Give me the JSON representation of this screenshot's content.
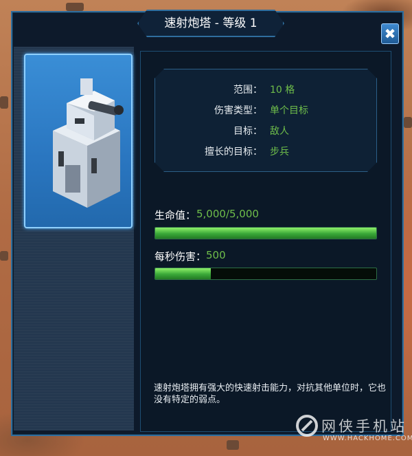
{
  "dialog": {
    "title": "速射炮塔 - 等级 1",
    "close_label": "✖"
  },
  "stats": [
    {
      "label": "范围：",
      "value": "10 格"
    },
    {
      "label": "伤害类型：",
      "value": "单个目标"
    },
    {
      "label": "目标：",
      "value": "敌人"
    },
    {
      "label": "擅长的目标：",
      "value": "步兵"
    }
  ],
  "health": {
    "label": "生命值：",
    "value": "5,000/5,000",
    "fraction": 1.0
  },
  "dps": {
    "label": "每秒伤害：",
    "value": "500",
    "fraction": 0.25
  },
  "description": "速射炮塔拥有强大的快速射击能力，对抗其他单位时，它也没有特定的弱点。",
  "watermark": {
    "main": "网侠手机站",
    "sub": "WWW.HACKHOME.COM"
  },
  "icons": {
    "portrait": "turret-icon",
    "close": "close-icon"
  },
  "colors": {
    "accent": "#2f6e9e",
    "value_green": "#6fbe4a",
    "bar_green": "#3aa838"
  }
}
